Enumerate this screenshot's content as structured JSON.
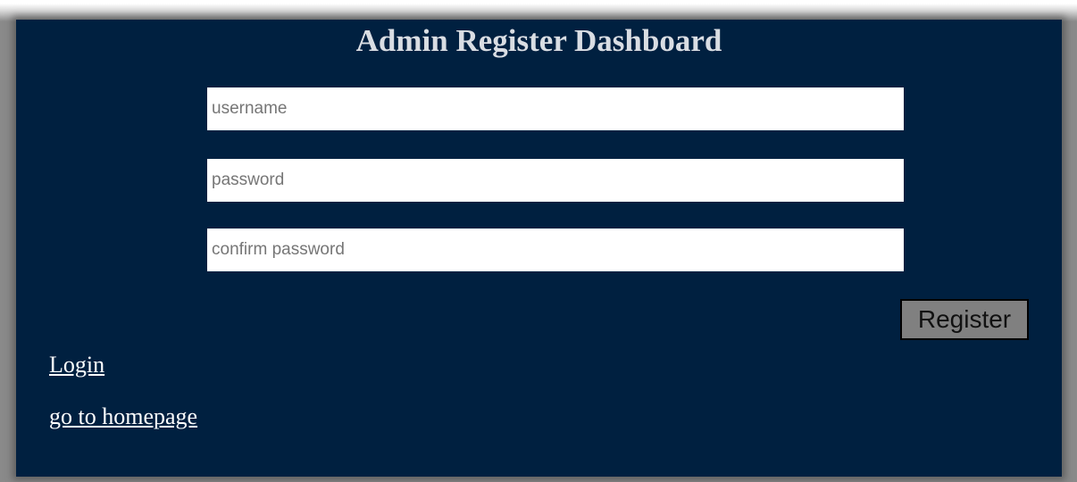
{
  "page": {
    "title": "Admin Register Dashboard"
  },
  "form": {
    "username_placeholder": "username",
    "password_placeholder": "password",
    "confirm_placeholder": "confirm password",
    "username_value": "",
    "password_value": "",
    "confirm_value": "",
    "register_label": "Register"
  },
  "links": {
    "login": "Login",
    "homepage": "go to homepage"
  },
  "colors": {
    "panel_bg": "#002040",
    "title_text": "#d9dde3",
    "button_bg": "#808080",
    "link_text": "#ffffff"
  }
}
